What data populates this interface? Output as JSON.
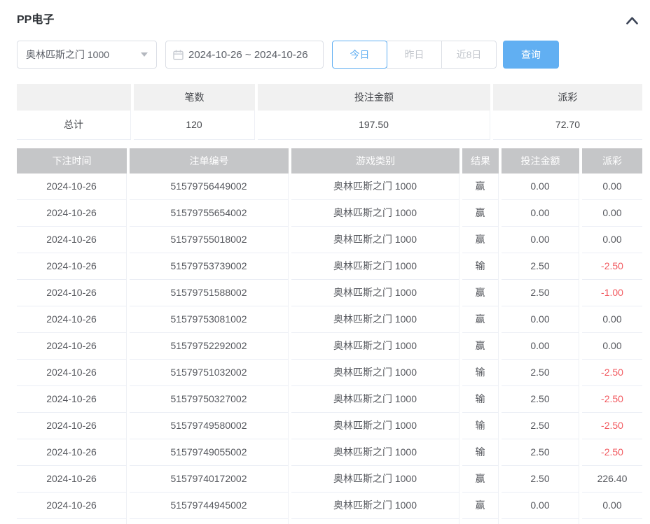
{
  "header": {
    "title": "PP电子",
    "collapse_icon": "chevron-up"
  },
  "controls": {
    "game_select": {
      "value": "奥林匹斯之门 1000"
    },
    "date_range": {
      "value": "2024-10-26 ~ 2024-10-26"
    },
    "quick_filters": [
      {
        "label": "今日",
        "active": true
      },
      {
        "label": "昨日",
        "active": false
      },
      {
        "label": "近8日",
        "active": false
      }
    ],
    "search_label": "查询"
  },
  "summary": {
    "columns": [
      "",
      "笔数",
      "投注金额",
      "派彩"
    ],
    "total": {
      "label": "总计",
      "count": "120",
      "bet_amount": "197.50",
      "payout": "72.70"
    }
  },
  "records": {
    "columns": [
      "下注时间",
      "注单编号",
      "游戏类别",
      "结果",
      "投注金额",
      "派彩"
    ],
    "rows": [
      [
        "2024-10-26",
        "51579756449002",
        "奥林匹斯之门 1000",
        "赢",
        "0.00",
        "0.00"
      ],
      [
        "2024-10-26",
        "51579755654002",
        "奥林匹斯之门 1000",
        "赢",
        "0.00",
        "0.00"
      ],
      [
        "2024-10-26",
        "51579755018002",
        "奥林匹斯之门 1000",
        "赢",
        "0.00",
        "0.00"
      ],
      [
        "2024-10-26",
        "51579753739002",
        "奥林匹斯之门 1000",
        "输",
        "2.50",
        "-2.50"
      ],
      [
        "2024-10-26",
        "51579751588002",
        "奥林匹斯之门 1000",
        "赢",
        "2.50",
        "-1.00"
      ],
      [
        "2024-10-26",
        "51579753081002",
        "奥林匹斯之门 1000",
        "赢",
        "0.00",
        "0.00"
      ],
      [
        "2024-10-26",
        "51579752292002",
        "奥林匹斯之门 1000",
        "赢",
        "0.00",
        "0.00"
      ],
      [
        "2024-10-26",
        "51579751032002",
        "奥林匹斯之门 1000",
        "输",
        "2.50",
        "-2.50"
      ],
      [
        "2024-10-26",
        "51579750327002",
        "奥林匹斯之门 1000",
        "输",
        "2.50",
        "-2.50"
      ],
      [
        "2024-10-26",
        "51579749580002",
        "奥林匹斯之门 1000",
        "输",
        "2.50",
        "-2.50"
      ],
      [
        "2024-10-26",
        "51579749055002",
        "奥林匹斯之门 1000",
        "输",
        "2.50",
        "-2.50"
      ],
      [
        "2024-10-26",
        "51579740172002",
        "奥林匹斯之门 1000",
        "赢",
        "2.50",
        "226.40"
      ],
      [
        "2024-10-26",
        "51579744945002",
        "奥林匹斯之门 1000",
        "赢",
        "0.00",
        "0.00"
      ]
    ]
  },
  "colors": {
    "accent": "#61aff2",
    "negative": "#f2595f",
    "table_header_bg": "#c5c6c8",
    "summary_header_bg": "#f1f1f1"
  }
}
